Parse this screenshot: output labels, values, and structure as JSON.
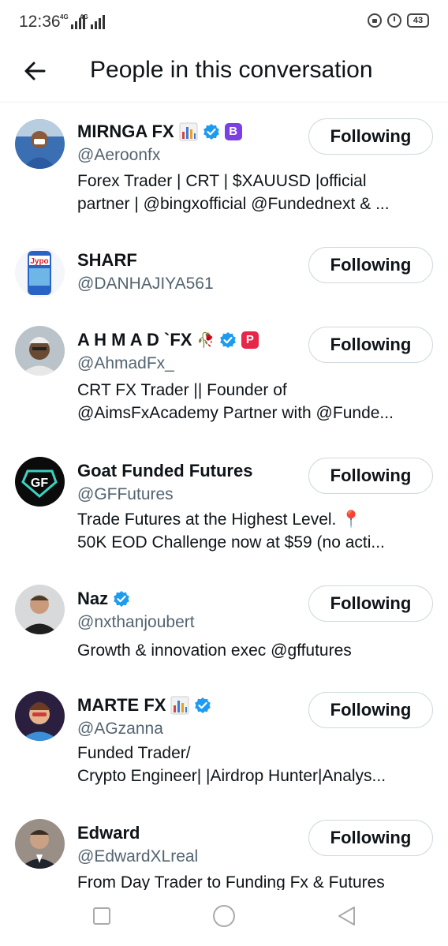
{
  "status_bar": {
    "time": "12:36",
    "net1": "4G",
    "net2": "4G",
    "battery": "43"
  },
  "header": {
    "title": "People in this conversation",
    "back_icon": "arrow-left-icon"
  },
  "colors": {
    "verified": "#1d9bf0",
    "text": "#0f1419",
    "secondary": "#536471",
    "border": "#cfd9de"
  },
  "people": [
    {
      "name": "MIRNGA FX",
      "handle": "@Aeroonfx",
      "bio": [
        "Forex Trader | CRT | $XAUUSD |official",
        "partner | @bingxofficial @Fundednext & ..."
      ],
      "button": "Following",
      "badges": [
        "chart-emoji",
        "verified-icon",
        "bold-b-icon"
      ]
    },
    {
      "name": "SHARF",
      "handle": "@DANHAJIYA561",
      "bio": [],
      "button": "Following",
      "badges": []
    },
    {
      "name": "A H M A D `FX",
      "handle": "@AhmadFx_",
      "bio": [
        "CRT FX Trader || Founder of",
        "@AimsFxAcademy Partner with @Funde..."
      ],
      "button": "Following",
      "badges": [
        "rose-emoji",
        "verified-icon",
        "p-icon"
      ]
    },
    {
      "name": "Goat Funded Futures",
      "handle": "@GFFutures",
      "bio": [
        "Trade Futures at the Highest Level. 📍",
        "50K EOD Challenge now at $59 (no acti..."
      ],
      "button": "Following",
      "badges": []
    },
    {
      "name": "Naz",
      "handle": "@nxthanjoubert",
      "bio": [
        "Growth & innovation exec @gffutures"
      ],
      "button": "Following",
      "badges": [
        "verified-icon"
      ]
    },
    {
      "name": "MARTE FX",
      "handle": "@AGzanna",
      "bio": [
        "Funded Trader/",
        "Crypto Engineer| |Airdrop Hunter|Analys..."
      ],
      "button": "Following",
      "badges": [
        "chart-emoji",
        "verified-icon"
      ]
    },
    {
      "name": "Edward",
      "handle": "@EdwardXLreal",
      "bio": [
        "From Day Trader to Funding Fx & Futures"
      ],
      "button": "Following",
      "badges": []
    }
  ]
}
